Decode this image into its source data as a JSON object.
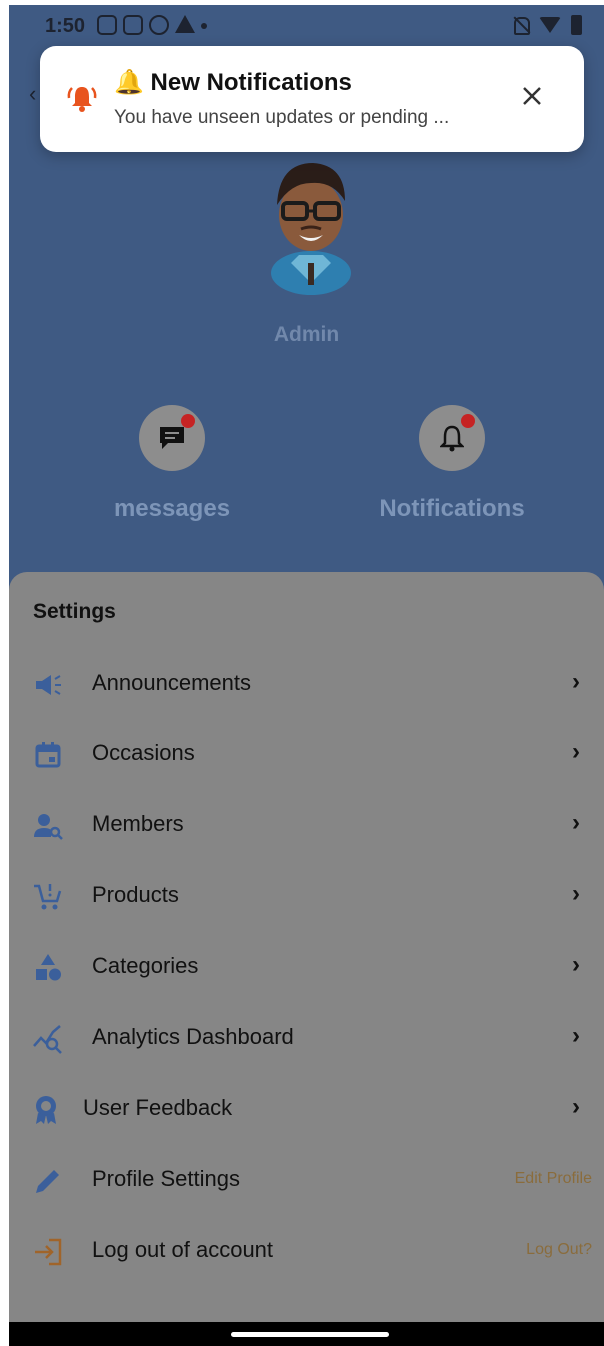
{
  "status_bar": {
    "time": "1:50"
  },
  "toast": {
    "title": "🔔 New Notifications",
    "message": "You have unseen updates or pending ...",
    "icon": "alarm-bell-icon",
    "close_icon": "close-icon"
  },
  "profile": {
    "name": "Admin"
  },
  "quick_actions": [
    {
      "label": "messages",
      "icon": "chat-icon"
    },
    {
      "label": "Notifications",
      "icon": "bell-icon"
    }
  ],
  "settings": {
    "title": "Settings",
    "items": [
      {
        "label": "Announcements",
        "icon": "megaphone-icon"
      },
      {
        "label": "Occasions",
        "icon": "calendar-icon"
      },
      {
        "label": "Members",
        "icon": "person-search-icon"
      },
      {
        "label": "Products",
        "icon": "cart-icon"
      },
      {
        "label": "Categories",
        "icon": "shapes-icon"
      },
      {
        "label": "Analytics Dashboard",
        "icon": "analytics-icon"
      },
      {
        "label": "User Feedback",
        "icon": "badge-icon"
      },
      {
        "label": "Profile Settings",
        "icon": "pencil-icon",
        "aux": "Edit Profile"
      },
      {
        "label": "Log out of account",
        "icon": "logout-icon",
        "aux": "Log Out?"
      }
    ]
  },
  "colors": {
    "header_bg": "#3f5a83",
    "sheet_bg": "#868686",
    "icon_blue": "#3b5f9b",
    "notification_dot": "#c62323",
    "toast_icon": "#e8541e"
  }
}
